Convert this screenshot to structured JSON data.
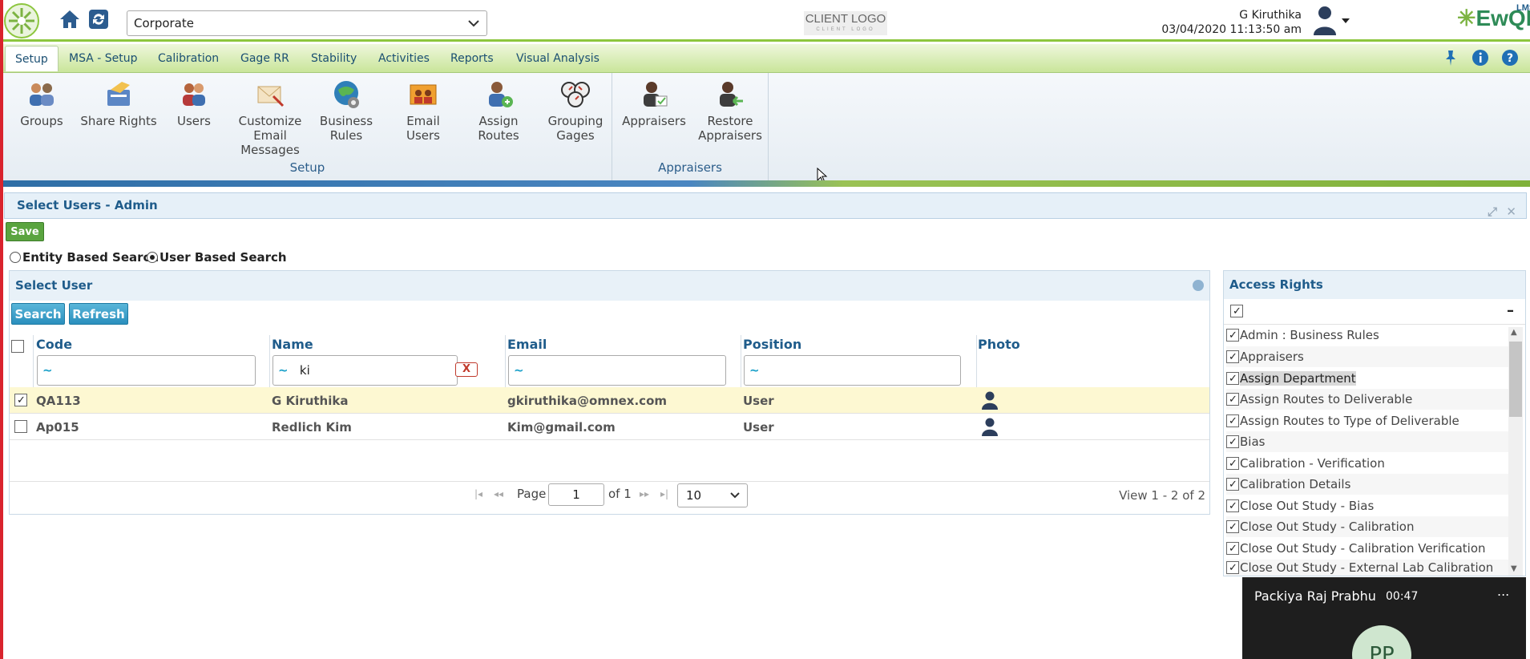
{
  "header": {
    "org_value": "Corporate",
    "client_logo": "CLIENT LOGO",
    "client_logo_sub": "CLIENT LOGO",
    "user_name": "G Kiruthika",
    "datetime": "03/04/2020 11:13:50 am",
    "brand": "EwQMS",
    "brand_small": "LMS"
  },
  "tabs": [
    {
      "label": "Setup"
    },
    {
      "label": "MSA - Setup"
    },
    {
      "label": "Calibration"
    },
    {
      "label": "Gage RR"
    },
    {
      "label": "Stability"
    },
    {
      "label": "Activities"
    },
    {
      "label": "Reports"
    },
    {
      "label": "Visual Analysis"
    }
  ],
  "ribbon": {
    "items": [
      {
        "label": "Groups"
      },
      {
        "label": "Share Rights"
      },
      {
        "label": "Users"
      },
      {
        "label": "Customize Email Messages"
      },
      {
        "label": "Business Rules"
      },
      {
        "label": "Email Users"
      },
      {
        "label": "Assign Routes"
      },
      {
        "label": "Grouping Gages"
      },
      {
        "label": "Appraisers"
      },
      {
        "label": "Restore Appraisers"
      }
    ],
    "group_setup": "Setup",
    "group_appraisers": "Appraisers"
  },
  "panel": {
    "title": "Select Users - Admin",
    "save": "Save",
    "radio_entity": "Entity Based Search",
    "radio_user": "User Based Search"
  },
  "select_user": {
    "title": "Select User",
    "search": "Search",
    "refresh": "Refresh",
    "columns": {
      "code": "Code",
      "name": "Name",
      "email": "Email",
      "position": "Position",
      "photo": "Photo"
    },
    "filters": {
      "tilde": "~",
      "name_value": "ki",
      "clear": "X"
    },
    "rows": [
      {
        "code": "QA113",
        "name": "G Kiruthika",
        "email": "gkiruthika@omnex.com",
        "position": "User",
        "checked": true
      },
      {
        "code": "Ap015",
        "name": "Redlich Kim",
        "email": "Kim@gmail.com",
        "position": "User",
        "checked": false
      }
    ],
    "pager": {
      "page_label": "Page",
      "page_value": "1",
      "of": "of 1",
      "size": "10",
      "view": "View 1 - 2 of 2"
    }
  },
  "access_rights": {
    "title": "Access Rights",
    "collapse": "–",
    "items": [
      "Admin : Business Rules",
      "Appraisers",
      "Assign Department",
      "Assign Routes to Deliverable",
      "Assign Routes to Type of Deliverable",
      "Bias",
      "Calibration - Verification",
      "Calibration Details",
      "Close Out Study - Bias",
      "Close Out Study - Calibration",
      "Close Out Study - Calibration Verification",
      "Close Out Study - External Lab Calibration"
    ]
  },
  "call": {
    "name": "Packiya Raj Prabhu",
    "time": "00:47",
    "initials": "PP",
    "more": "..."
  }
}
